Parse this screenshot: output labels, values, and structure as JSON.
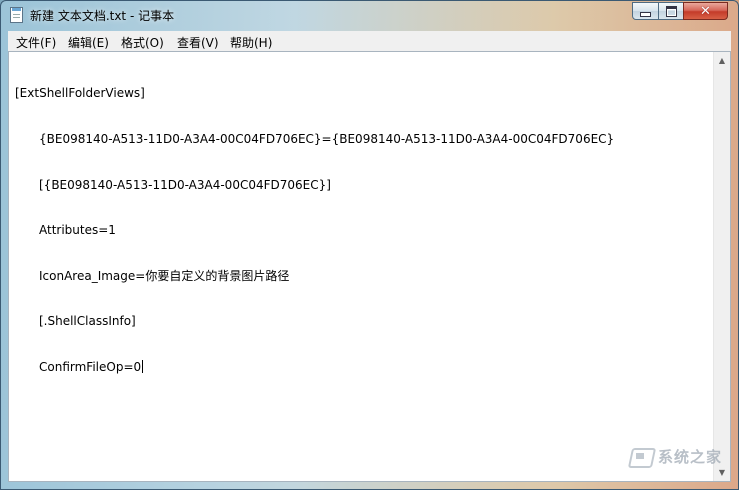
{
  "window": {
    "title": "新建 文本文档.txt - 记事本"
  },
  "menu": {
    "items": [
      {
        "label": "文件(F)"
      },
      {
        "label": "编辑(E)"
      },
      {
        "label": "格式(O)"
      },
      {
        "label": "查看(V)"
      },
      {
        "label": "帮助(H)"
      }
    ]
  },
  "editor": {
    "lines": [
      "[ExtShellFolderViews]",
      "{BE098140-A513-11D0-A3A4-00C04FD706EC}={BE098140-A513-11D0-A3A4-00C04FD706EC}",
      "[{BE098140-A513-11D0-A3A4-00C04FD706EC}]",
      "Attributes=1",
      "IconArea_Image=你要自定义的背景图片路径",
      "[.ShellClassInfo]",
      "ConfirmFileOp=0"
    ]
  },
  "watermark": {
    "text": "系统之家"
  },
  "icons": {
    "app": "notepad-icon",
    "minimize": "minimize-icon",
    "maximize": "maximize-icon",
    "close": "close-icon",
    "scroll_up": "arrow-up-icon",
    "scroll_down": "arrow-down-icon"
  }
}
